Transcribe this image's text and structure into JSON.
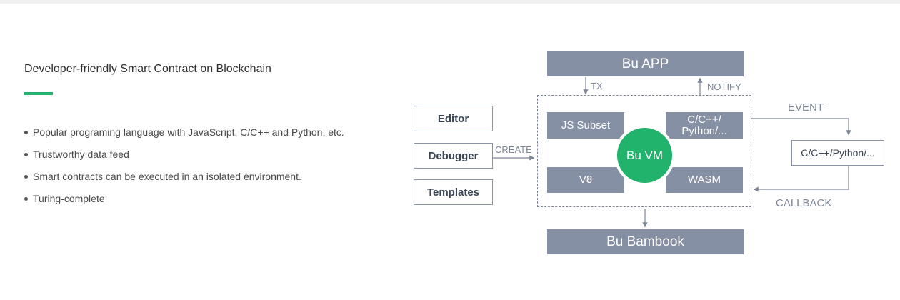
{
  "heading": "Developer-friendly Smart Contract on Blockchain",
  "accent_color": "#21b36b",
  "features": [
    "Popular programing language with JavaScript, C/C++ and Python, etc.",
    "Trustworthy data feed",
    "Smart contracts can be executed in an isolated environment.",
    "Turing-complete"
  ],
  "diagram": {
    "top_bar": "Bu APP",
    "bottom_bar": "Bu Bambook",
    "tools": [
      "Editor",
      "Debugger",
      "Templates"
    ],
    "vm_label": "Bu VM",
    "modules": {
      "js_subset": "JS Subset",
      "c_python_line1": "C/C++/",
      "c_python_line2": "Python/...",
      "v8": "V8",
      "wasm": "WASM"
    },
    "external_box": "C/C++/Python/...",
    "labels": {
      "tx": "TX",
      "notify": "NOTIFY",
      "create": "CREATE",
      "event": "EVENT",
      "callback": "CALLBACK"
    }
  }
}
